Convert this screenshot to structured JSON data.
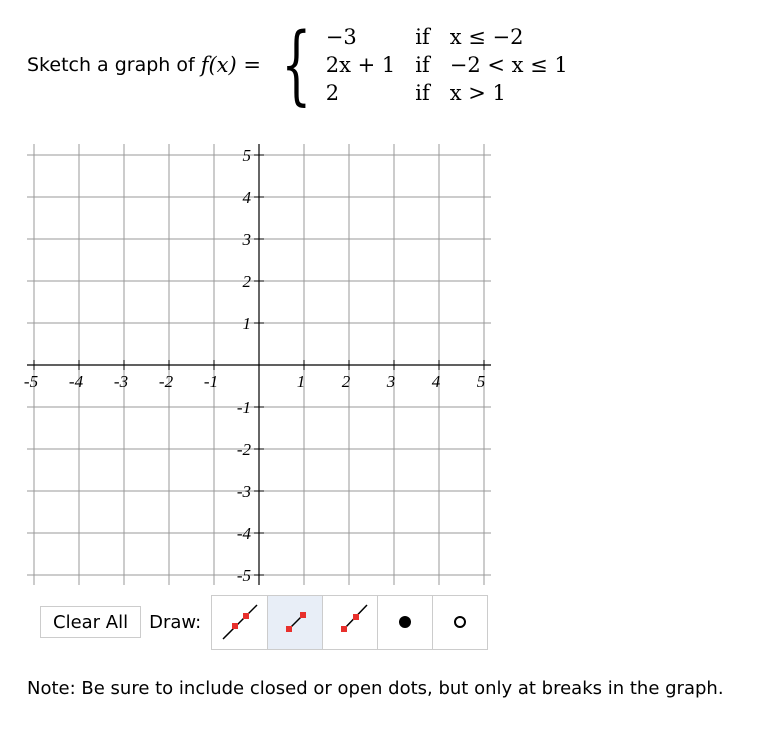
{
  "prompt": {
    "lead_text": "Sketch a graph of",
    "function_name": "f(x) =",
    "cases": [
      {
        "expr": "−3",
        "if": "if",
        "cond": "x ≤ −2"
      },
      {
        "expr": "2x + 1",
        "if": "if",
        "cond": "−2 < x ≤ 1"
      },
      {
        "expr": "2",
        "if": "if",
        "cond": "x > 1"
      }
    ]
  },
  "graph": {
    "x_range": [
      -5,
      5
    ],
    "y_range": [
      -5,
      5
    ],
    "x_ticks": [
      "-5",
      "-4",
      "-3",
      "-2",
      "-1",
      "1",
      "2",
      "3",
      "4",
      "5"
    ],
    "y_ticks": [
      "5",
      "4",
      "3",
      "2",
      "1",
      "-1",
      "-2",
      "-3",
      "-4",
      "-5"
    ]
  },
  "toolbar": {
    "clear_label": "Clear All",
    "draw_label": "Draw:",
    "tools": [
      {
        "name": "line-tool",
        "icon": "line-icon",
        "active": false
      },
      {
        "name": "segment-tool",
        "icon": "segment-icon",
        "active": true
      },
      {
        "name": "ray-tool",
        "icon": "ray-icon",
        "active": false
      },
      {
        "name": "closed-dot-tool",
        "icon": "closed-dot-icon",
        "active": false
      },
      {
        "name": "open-dot-tool",
        "icon": "open-dot-icon",
        "active": false
      }
    ]
  },
  "note": "Note: Be sure to include closed or open dots, but only at breaks in the graph.",
  "colors": {
    "grid": "#999999",
    "axis": "#000000",
    "handle": "#e8302c",
    "active_tool_bg": "#e8eef7"
  }
}
